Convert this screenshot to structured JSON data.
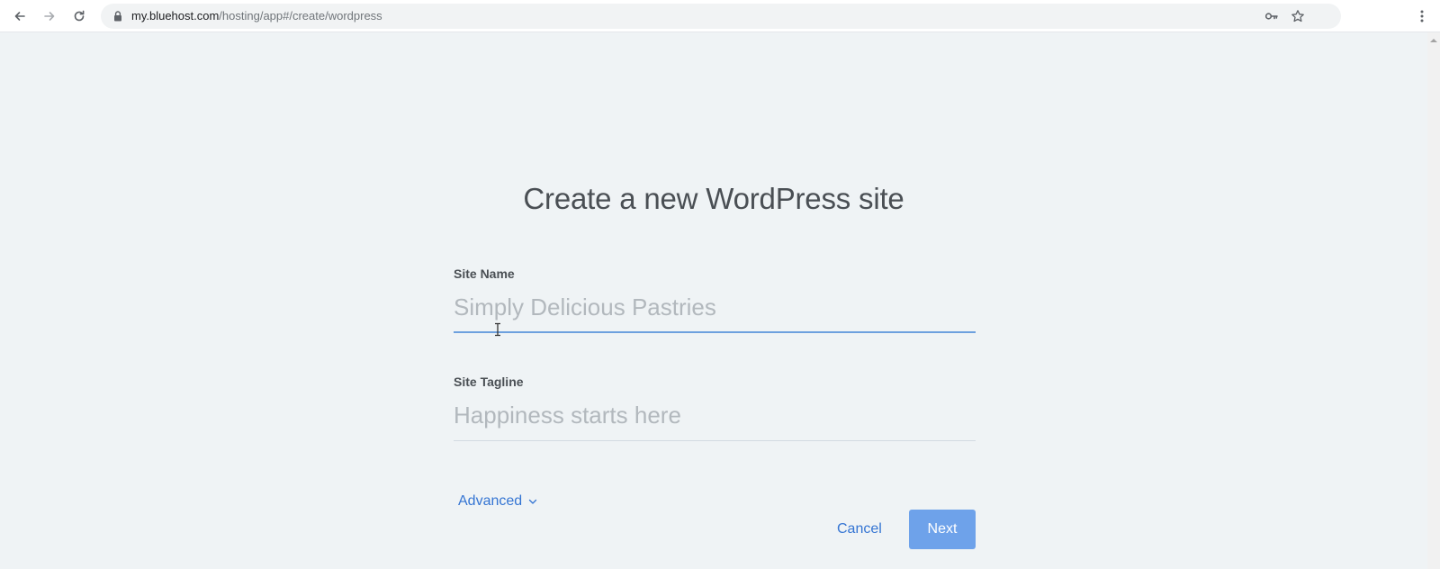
{
  "browser": {
    "url_host": "my.bluehost.com",
    "url_path": "/hosting/app#/create/wordpress",
    "icons": {
      "back": "arrow-left-icon",
      "forward": "arrow-right-icon",
      "reload": "reload-icon",
      "lock": "lock-icon",
      "password": "key-icon",
      "bookmark": "star-icon",
      "menu": "kebab-menu-icon"
    }
  },
  "page": {
    "title": "Create a new WordPress site"
  },
  "form": {
    "site_name": {
      "label": "Site Name",
      "value": "",
      "placeholder": "Simply Delicious Pastries"
    },
    "site_tagline": {
      "label": "Site Tagline",
      "value": "",
      "placeholder": "Happiness starts here"
    },
    "advanced_label": "Advanced",
    "cancel_label": "Cancel",
    "next_label": "Next"
  },
  "colors": {
    "page_background": "#eff3f5",
    "link": "#3575d3",
    "primary_button": "#6ea2ea",
    "focus_underline": "#6da0de",
    "title_text": "#4a4f54",
    "placeholder_text": "#b2b8bd"
  }
}
